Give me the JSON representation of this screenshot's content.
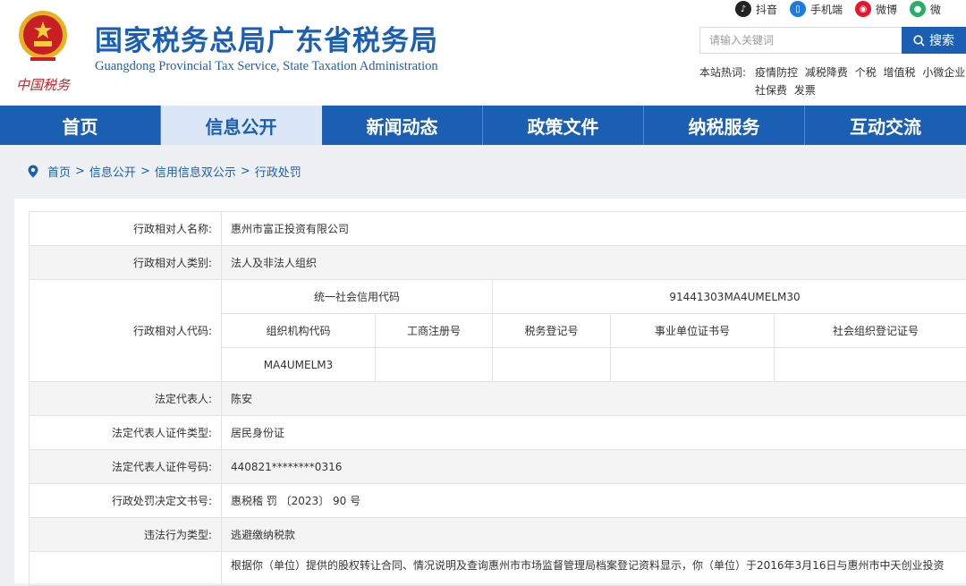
{
  "header": {
    "title_cn": "国家税务总局广东省税务局",
    "title_en": "Guangdong Provincial Tax Service, State Taxation Administration",
    "emblem_caption": "中国税务",
    "social": [
      {
        "label": "抖音",
        "icon": "douyin-icon",
        "color": "#222222"
      },
      {
        "label": "手机端",
        "icon": "mobile-icon",
        "color": "#1b7be0"
      },
      {
        "label": "微博",
        "icon": "weibo-icon",
        "color": "#e6162d"
      },
      {
        "label": "微",
        "icon": "wechat-icon",
        "color": "#2aae67"
      }
    ],
    "search": {
      "placeholder": "请输入关键词",
      "button": "搜索"
    },
    "hot": {
      "label": "本站热词:",
      "row1": [
        "疫情防控",
        "减税降费",
        "个税",
        "增值税",
        "小微企业"
      ],
      "row2": [
        "社保费",
        "发票"
      ]
    }
  },
  "nav": {
    "items": [
      "首页",
      "信息公开",
      "新闻动态",
      "政策文件",
      "纳税服务",
      "互动交流"
    ],
    "active_index": 1
  },
  "breadcrumb": [
    "首页",
    "信息公开",
    "信用信息双公示",
    "行政处罚"
  ],
  "record": {
    "name_label": "行政相对人名称:",
    "name": "惠州市富正投资有限公司",
    "type_label": "行政相对人类别:",
    "type": "法人及非法人组织",
    "code_label": "行政相对人代码:",
    "uscc_label": "统一社会信用代码",
    "uscc": "91441303MA4UMELM30",
    "org_code_label": "组织机构代码",
    "biz_reg_label": "工商注册号",
    "tax_reg_label": "税务登记号",
    "inst_cert_label": "事业单位证书号",
    "social_org_label": "社会组织登记证号",
    "org_code": "MA4UMELM3",
    "biz_reg": "",
    "tax_reg": "",
    "inst_cert": "",
    "social_org": "",
    "legal_rep_label": "法定代表人:",
    "legal_rep": "陈安",
    "id_type_label": "法定代表人证件类型:",
    "id_type": "居民身份证",
    "id_no_label": "法定代表人证件号码:",
    "id_no": "440821********0316",
    "doc_no_label": "行政处罚决定文书号:",
    "doc_no": "惠税稽 罚 〔2023〕 90 号",
    "violation_label": "违法行为类型:",
    "violation": "逃避缴纳税款",
    "desc_label": "",
    "desc": "根据你（单位）提供的股权转让合同、情况说明及查询惠州市市场监督管理局档案登记资料显示，你（单位）于2016年3月16日与惠州市中天创业投资"
  },
  "colors": {
    "brand_blue": "#1b5fb5",
    "nav_active_bg": "#dbe7f6",
    "emblem_red": "#c81f25",
    "emblem_gold": "#e6b422"
  }
}
